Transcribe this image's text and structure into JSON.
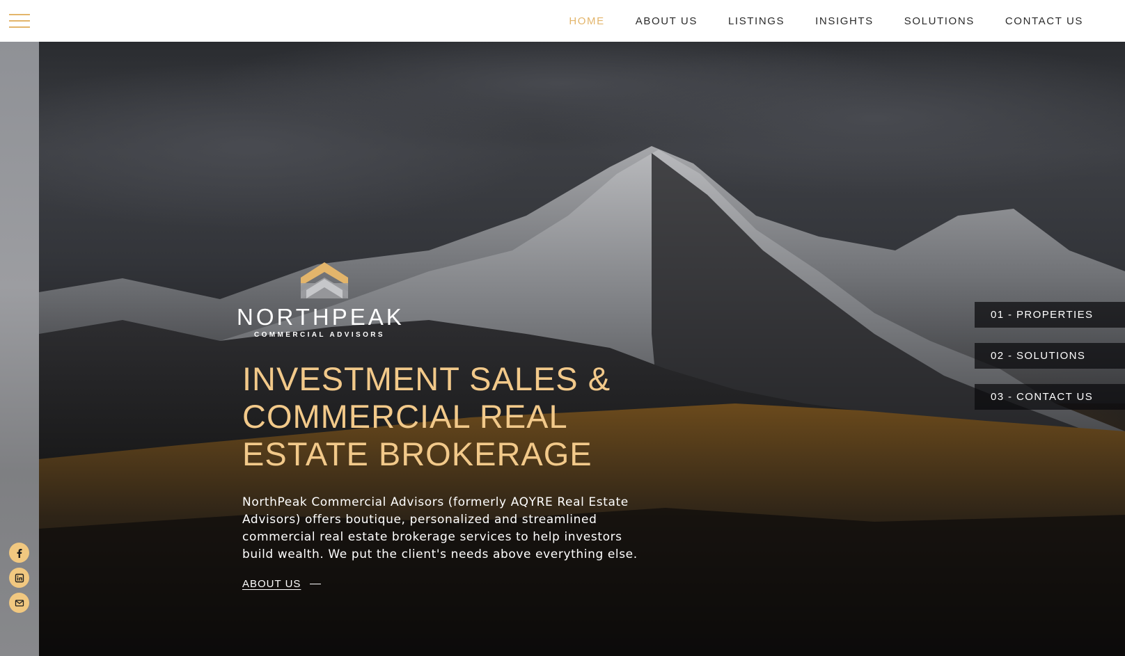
{
  "header": {
    "menu_icon": "hamburger-menu-icon",
    "nav": [
      {
        "label": "HOME",
        "active": true
      },
      {
        "label": "ABOUT US",
        "active": false
      },
      {
        "label": "LISTINGS",
        "active": false
      },
      {
        "label": "INSIGHTS",
        "active": false
      },
      {
        "label": "SOLUTIONS",
        "active": false
      },
      {
        "label": "CONTACT US",
        "active": false
      }
    ]
  },
  "brand": {
    "name": "NORTHPEAK",
    "tagline": "COMMERCIAL ADVISORS",
    "accent_color": "#e3b56b",
    "icon": "peak-logo-icon"
  },
  "hero": {
    "headline_lines": [
      "INVESTMENT SALES &",
      "COMMERCIAL REAL",
      "ESTATE BROKERAGE"
    ],
    "description": "NorthPeak Commercial Advisors (formerly AQYRE Real Estate Advisors) offers boutique, personalized and streamlined commercial real estate brokerage services to help investors build wealth. We put the client's needs above everything else.",
    "cta_label": "ABOUT US"
  },
  "quick_links": [
    {
      "label": "01 - PROPERTIES"
    },
    {
      "label": "02 - SOLUTIONS"
    },
    {
      "label": "03 - CONTACT US"
    }
  ],
  "social": [
    {
      "icon": "facebook-icon"
    },
    {
      "icon": "linkedin-icon"
    },
    {
      "icon": "email-icon"
    }
  ],
  "colors": {
    "header_bg": "#ffffff",
    "nav_text": "#2a2a2a",
    "headline": "#f2c98a",
    "social_bg": "#f1c880"
  }
}
